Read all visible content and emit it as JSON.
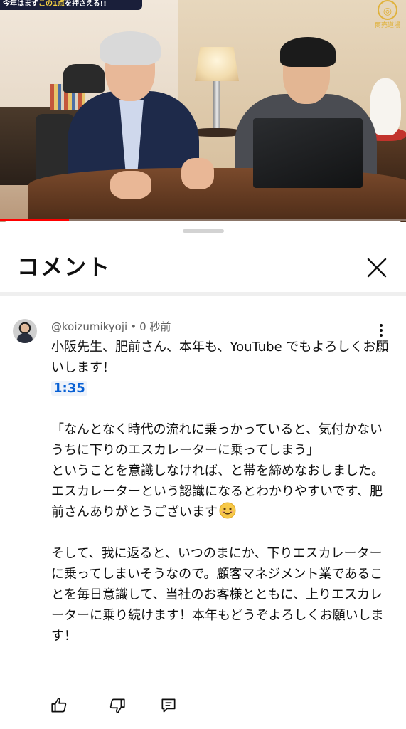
{
  "video": {
    "banner_text_prefix": "今年はまず",
    "banner_text_highlight": "この1点",
    "banner_text_suffix": "を押さえる!!",
    "channel_logo_caption": "商売道場",
    "progress_percent": 17
  },
  "sheet": {
    "title": "コメント"
  },
  "comment": {
    "author": "@koizumikyoji",
    "time": "0 秒前",
    "line1": "小阪先生、肥前さん、本年も、YouTube でもよろしくお願いします！",
    "timestamp": "1:35",
    "quote": "「なんとなく時代の流れに乗っかっていると、気付かないうちに下りのエスカレーターに乗ってしまう」",
    "line3": "ということを意識しなければ、と帯を締めなおしました。",
    "line4": "エスカレーターという認識になるとわかりやすいです、肥前さんありがとうございます",
    "line5": "そして、我に返ると、いつのまにか、下りエスカレーターに乗ってしまいそうなので。顧客マネジメント業であることを毎日意識して、当社のお客様とともに、上りエスカレーターに乗り続けます！本年もどうぞよろしくお願いします！"
  },
  "icons": {
    "close": "close-icon",
    "more": "more-vert-icon",
    "like": "thumbs-up-icon",
    "dislike": "thumbs-down-icon",
    "reply": "reply-icon",
    "emoji": "smiling-face-icon"
  },
  "colors": {
    "link_blue": "#065fd4",
    "meta_gray": "#606060",
    "progress_red": "#ff0000"
  }
}
